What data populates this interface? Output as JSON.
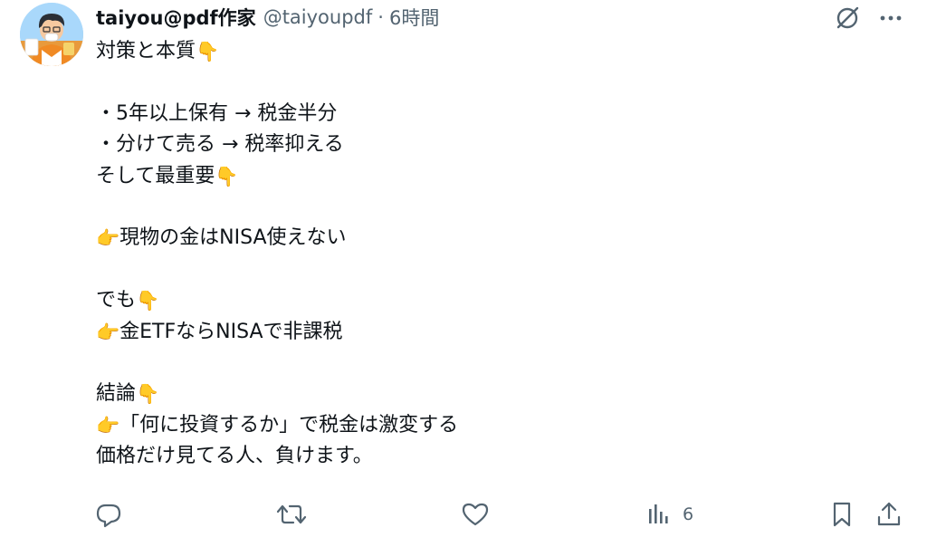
{
  "post": {
    "author": {
      "name": "taiyou@pdf作家",
      "handle": "@taiyoupdf",
      "separator": "·",
      "time": "6時間"
    },
    "body": {
      "lines": [
        {
          "text": "対策と本質",
          "emoji_after": "👇",
          "emoji_before": ""
        },
        {
          "text": "",
          "emoji_after": "",
          "emoji_before": ""
        },
        {
          "text": "・5年以上保有 → 税金半分",
          "emoji_after": "",
          "emoji_before": ""
        },
        {
          "text": "・分けて売る → 税率抑える",
          "emoji_after": "",
          "emoji_before": ""
        },
        {
          "text": "そして最重要",
          "emoji_after": "👇",
          "emoji_before": ""
        },
        {
          "text": "",
          "emoji_after": "",
          "emoji_before": ""
        },
        {
          "text": "現物の金はNISA使えない",
          "emoji_after": "",
          "emoji_before": "👉"
        },
        {
          "text": "",
          "emoji_after": "",
          "emoji_before": ""
        },
        {
          "text": "でも",
          "emoji_after": "👇",
          "emoji_before": ""
        },
        {
          "text": "金ETFならNISAで非課税",
          "emoji_after": "",
          "emoji_before": "👉"
        },
        {
          "text": "",
          "emoji_after": "",
          "emoji_before": ""
        },
        {
          "text": "結論",
          "emoji_after": "👇",
          "emoji_before": ""
        },
        {
          "text": "「何に投資するか」で税金は激変する",
          "emoji_after": "",
          "emoji_before": "👉"
        },
        {
          "text": "価格だけ見てる人、負けます。",
          "emoji_after": "",
          "emoji_before": ""
        }
      ]
    },
    "actions": {
      "views_count": "6"
    }
  },
  "icons": {
    "grok": "grok-slash-circle-icon",
    "more": "more-dots-icon",
    "reply": "reply-bubble-icon",
    "repost": "repost-arrows-icon",
    "like": "heart-icon",
    "views": "bar-chart-icon",
    "bookmark": "bookmark-icon",
    "share": "share-upload-icon"
  },
  "colors": {
    "text": "#0f1419",
    "secondary": "#536471",
    "background": "#ffffff"
  }
}
